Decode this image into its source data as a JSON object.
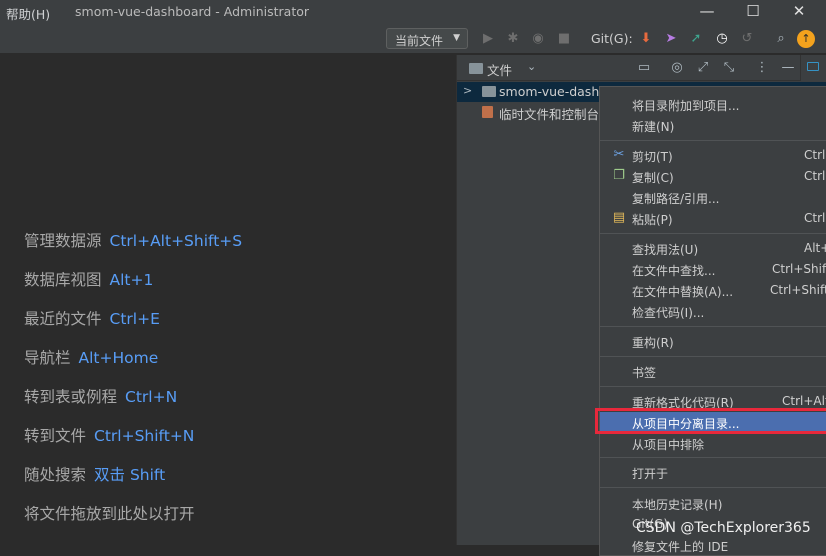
{
  "titlebar": {
    "menu_help": "帮助(H)",
    "title": "smom-vue-dashboard - Administrator",
    "minimize": "—",
    "maximize": "☐",
    "close": "✕"
  },
  "toolbar": {
    "run_config": "当前文件",
    "git_label": "Git(G):",
    "colors": {
      "update": "#e86a3e",
      "commit": "#b77ce3",
      "push": "#3ea58e",
      "history": "#ffffff",
      "avatar": "#f4a21d"
    }
  },
  "editor": {
    "hints": [
      {
        "label": "管理数据源",
        "key": "Ctrl+Alt+Shift+S"
      },
      {
        "label": "数据库视图",
        "key": "Alt+1"
      },
      {
        "label": "最近的文件",
        "key": "Ctrl+E"
      },
      {
        "label": "导航栏",
        "key": "Alt+Home"
      },
      {
        "label": "转到表或例程",
        "key": "Ctrl+N"
      },
      {
        "label": "转到文件",
        "key": "Ctrl+Shift+N"
      },
      {
        "label": "随处搜索",
        "key": "双击 Shift"
      },
      {
        "label": "将文件拖放到此处以打开",
        "key": ""
      }
    ]
  },
  "project": {
    "title": "文件",
    "tree": [
      {
        "label": "smom-vue-dashb"
      },
      {
        "label": "临时文件和控制台"
      }
    ]
  },
  "context_menu": {
    "items": [
      {
        "label": "将目录附加到项目...",
        "shortcut": ""
      },
      {
        "label": "新建(N)",
        "shortcut": ""
      },
      {
        "label": "剪切(T)",
        "shortcut": "Ctrl"
      },
      {
        "label": "复制(C)",
        "shortcut": "Ctrl"
      },
      {
        "label": "复制路径/引用...",
        "shortcut": ""
      },
      {
        "label": "粘贴(P)",
        "shortcut": "Ctrl"
      },
      {
        "label": "查找用法(U)",
        "shortcut": "Alt+"
      },
      {
        "label": "在文件中查找...",
        "shortcut": "Ctrl+Shift"
      },
      {
        "label": "在文件中替换(A)...",
        "shortcut": "Ctrl+Shift"
      },
      {
        "label": "检查代码(I)...",
        "shortcut": ""
      },
      {
        "label": "重构(R)",
        "shortcut": ""
      },
      {
        "label": "书签",
        "shortcut": ""
      },
      {
        "label": "重新格式化代码(R)",
        "shortcut": "Ctrl+Alt"
      },
      {
        "label": "从项目中分离目录...",
        "shortcut": ""
      },
      {
        "label": "从项目中排除",
        "shortcut": ""
      },
      {
        "label": "打开于",
        "shortcut": ""
      },
      {
        "label": "本地历史记录(H)",
        "shortcut": ""
      },
      {
        "label": "Git(G)",
        "shortcut": ""
      },
      {
        "label": "修复文件上的 IDE",
        "shortcut": ""
      }
    ],
    "selected_color": "#4b6eaf",
    "highlight_color": "#e8283b"
  },
  "watermark": "CSDN @TechExplorer365"
}
